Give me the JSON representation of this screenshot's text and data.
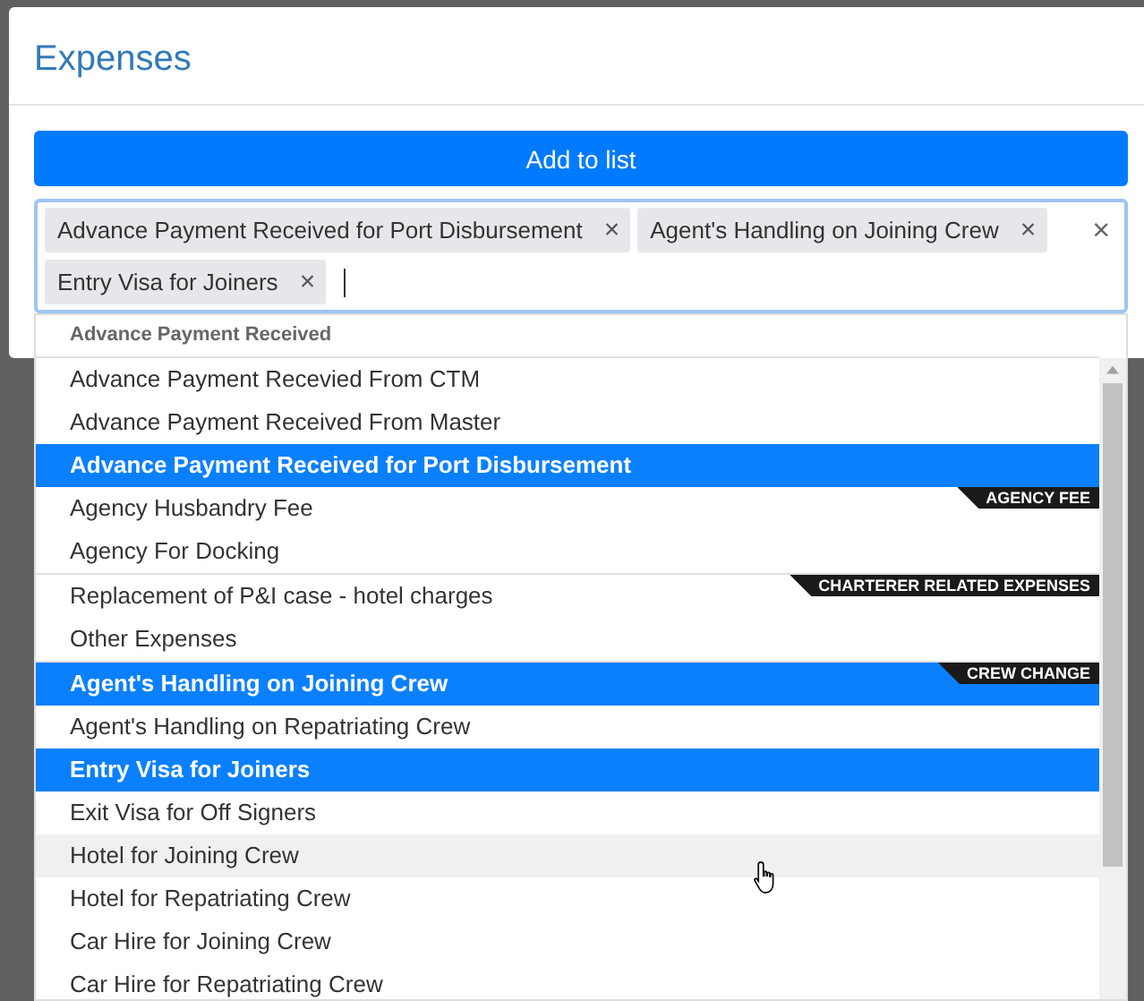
{
  "modal": {
    "title": "Expenses"
  },
  "add_button": "Add to list",
  "selection": {
    "chips": [
      {
        "label": "Advance Payment Received for Port Disbursement",
        "remove": "×"
      },
      {
        "label": "Agent's Handling on Joining Crew",
        "remove": "×"
      },
      {
        "label": "Entry Visa for Joiners",
        "remove": "×"
      }
    ],
    "clear": "×"
  },
  "dropdown": {
    "groups": [
      {
        "label": "Advance Payment Received",
        "kind": "header",
        "items": [
          {
            "label": "Advance Payment Recevied From CTM",
            "selected": false,
            "hovered": false
          },
          {
            "label": "Advance Payment Received From Master",
            "selected": false,
            "hovered": false
          },
          {
            "label": "Advance Payment Received for Port Disbursement",
            "selected": true,
            "hovered": false
          }
        ]
      },
      {
        "label": "AGENCY FEE",
        "kind": "ribbon",
        "items": [
          {
            "label": "Agency Husbandry Fee",
            "selected": false,
            "hovered": false
          },
          {
            "label": "Agency For Docking",
            "selected": false,
            "hovered": false
          }
        ]
      },
      {
        "label": "CHARTERER RELATED EXPENSES",
        "kind": "ribbon",
        "items": [
          {
            "label": "Replacement of P&I case - hotel charges",
            "selected": false,
            "hovered": false
          },
          {
            "label": "Other Expenses",
            "selected": false,
            "hovered": false
          }
        ]
      },
      {
        "label": "CREW CHANGE",
        "kind": "ribbon",
        "items": [
          {
            "label": "Agent's Handling on Joining Crew",
            "selected": true,
            "hovered": false
          },
          {
            "label": "Agent's Handling on Repatriating Crew",
            "selected": false,
            "hovered": false
          },
          {
            "label": "Entry Visa for Joiners",
            "selected": true,
            "hovered": false
          },
          {
            "label": "Exit Visa for Off Signers",
            "selected": false,
            "hovered": false
          },
          {
            "label": "Hotel for Joining Crew",
            "selected": false,
            "hovered": true
          },
          {
            "label": "Hotel for Repatriating Crew",
            "selected": false,
            "hovered": false
          },
          {
            "label": "Car Hire for Joining Crew",
            "selected": false,
            "hovered": false
          },
          {
            "label": "Car Hire for Repatriating Crew",
            "selected": false,
            "hovered": false
          }
        ]
      }
    ]
  }
}
